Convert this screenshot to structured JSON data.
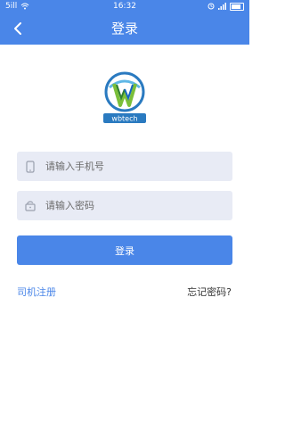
{
  "status_bar": {
    "carrier_left": "5ill",
    "time": "16:32",
    "icons": [
      "signal-icon",
      "wifi-icon",
      "alarm-icon",
      "battery-icon"
    ]
  },
  "header": {
    "title": "登录",
    "back_icon": "chevron-left-icon"
  },
  "logo": {
    "text": "wbtech"
  },
  "form": {
    "phone": {
      "placeholder": "请输入手机号",
      "value": "",
      "icon": "phone-icon"
    },
    "password": {
      "placeholder": "请输入密码",
      "value": "",
      "icon": "lock-icon"
    },
    "submit_label": "登录"
  },
  "links": {
    "register": "司机注册",
    "forgot": "忘记密码?"
  },
  "colors": {
    "accent": "#4a86e8",
    "field_bg": "#e8ebf5"
  }
}
